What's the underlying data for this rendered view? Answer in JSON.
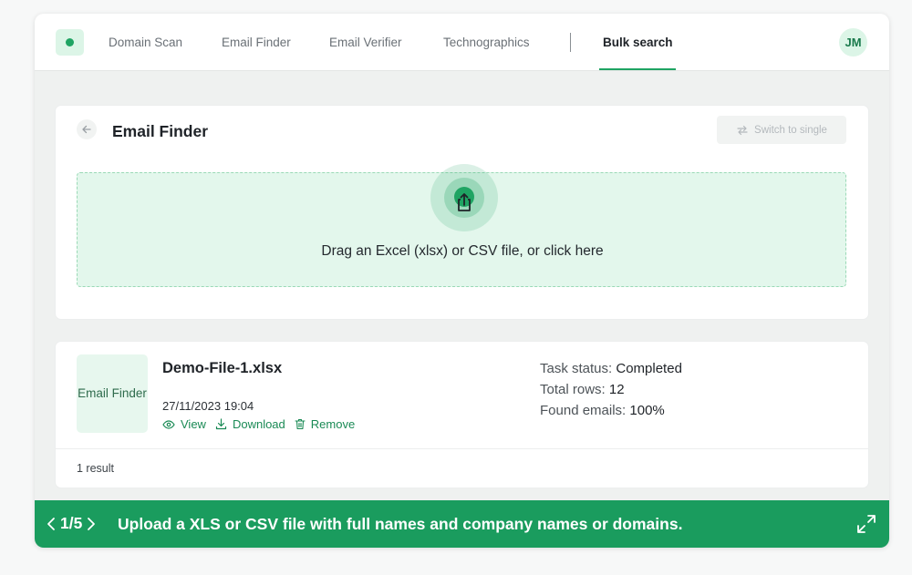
{
  "nav": {
    "items": [
      {
        "label": "Domain Scan"
      },
      {
        "label": "Email Finder"
      },
      {
        "label": "Email Verifier"
      },
      {
        "label": "Technographics"
      },
      {
        "label": "Bulk search"
      }
    ],
    "active_index": 4
  },
  "user": {
    "initials": "JM"
  },
  "upload": {
    "title": "Email Finder",
    "switch_label": "Switch to single",
    "drop_text": "Drag an Excel (xlsx) or CSV file, or click here"
  },
  "result": {
    "type_badge": "Email Finder",
    "file_name": "Demo-File-1.xlsx",
    "date": "27/11/2023 19:04",
    "actions": {
      "view": "View",
      "download": "Download",
      "remove": "Remove"
    },
    "stats": {
      "status_label": "Task status:",
      "status_value": "Completed",
      "rows_label": "Total rows:",
      "rows_value": "12",
      "found_label": "Found emails:",
      "found_value": "100%"
    },
    "count": "1 result"
  },
  "tour": {
    "step": "1/5",
    "text": "Upload a XLS or CSV file with full names and company names or domains."
  },
  "colors": {
    "brand": "#1fa463",
    "banner": "#1a9c5e",
    "accent_light": "#e3f7ec"
  },
  "icons": [
    "logo-dot-icon",
    "arrow-left-icon",
    "swap-icon",
    "upload-icon",
    "eye-icon",
    "download-icon",
    "trash-icon",
    "chevron-left-icon",
    "chevron-right-icon",
    "expand-icon"
  ]
}
